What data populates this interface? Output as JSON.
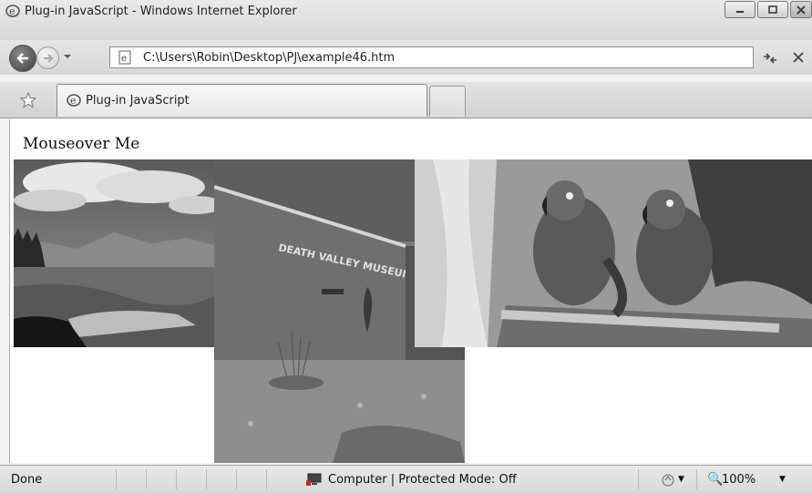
{
  "window": {
    "title": "Plug-in JavaScript - Windows Internet Explorer",
    "controls": [
      "minimize-icon",
      "maximize-icon",
      "close-icon"
    ]
  },
  "navigation": {
    "address": "C:\\Users\\Robin\\Desktop\\PJ\\example46.htm",
    "back_icon": "back-arrow-icon",
    "forward_icon": "forward-arrow-icon",
    "refresh_icon": "refresh-icon",
    "stop_icon": "stop-icon"
  },
  "tabs": [
    {
      "label": "Plug-in JavaScript",
      "icon": "ie-page-icon",
      "active": true
    }
  ],
  "favorites_icon": "star-icon",
  "page": {
    "heading": "Mouseover Me",
    "images": [
      {
        "name": "landscape-image",
        "description_icon": "mountains-photo"
      },
      {
        "name": "museum-image",
        "description_icon": "building-photo"
      },
      {
        "name": "parrots-image",
        "description_icon": "birds-photo"
      }
    ]
  },
  "statusbar": {
    "status": "Done",
    "zone": "Computer | Protected Mode: Off",
    "zoom": "100%"
  },
  "colors": {
    "chrome": "#e0e0e0",
    "border": "#8c8c8c"
  }
}
